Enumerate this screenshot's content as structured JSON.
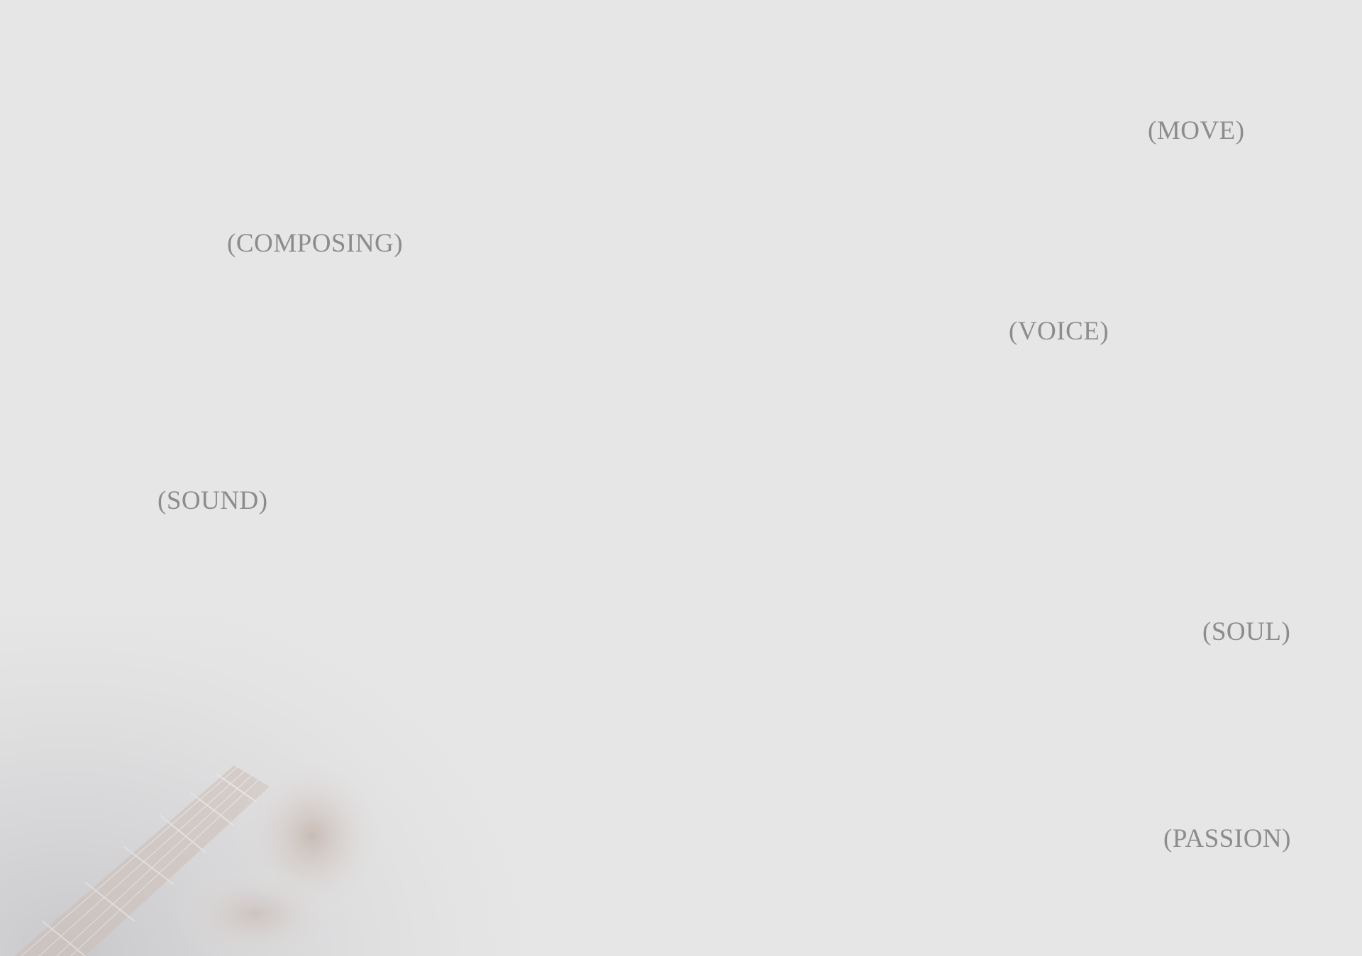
{
  "background_color": "#e6e6e6",
  "text_color": "#8c8c8c",
  "words": {
    "move": "(MOVE)",
    "composing": "(COMPOSING)",
    "voice": "(VOICE)",
    "sound": "(SOUND)",
    "soul": "(SOUL)",
    "passion": "(PASSION)"
  },
  "image": {
    "subject": "faded-guitar-neck-with-hand"
  }
}
